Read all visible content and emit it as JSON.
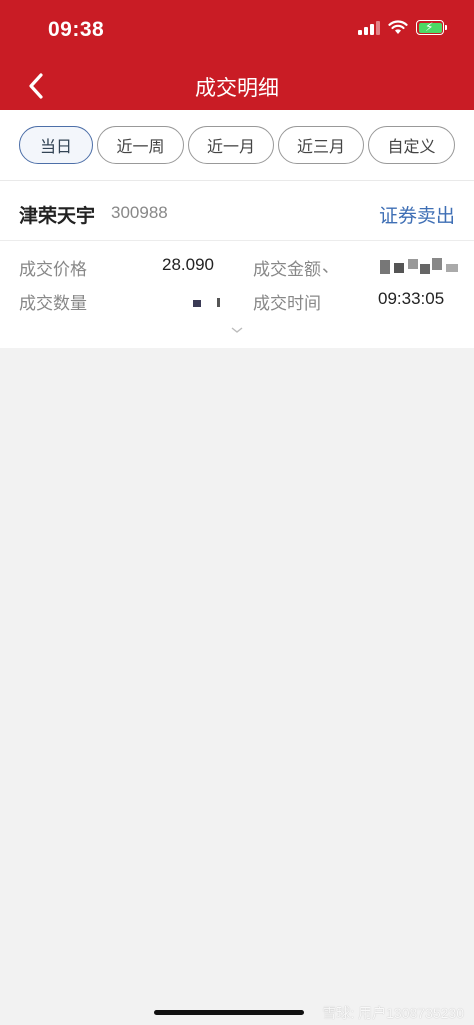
{
  "status_bar": {
    "time": "09:38"
  },
  "nav": {
    "title": "成交明细"
  },
  "filters": [
    {
      "label": "当日",
      "active": true
    },
    {
      "label": "近一周",
      "active": false
    },
    {
      "label": "近一月",
      "active": false
    },
    {
      "label": "近三月",
      "active": false
    },
    {
      "label": "自定义",
      "active": false
    }
  ],
  "trade": {
    "stock_name": "津荣天宇",
    "stock_code": "300988",
    "trade_type": "证券卖出",
    "price_label": "成交价格",
    "price_value": "28.090",
    "amount_label": "成交金额",
    "quantity_label": "成交数量",
    "time_label": "成交时间",
    "time_value": "09:33:05"
  },
  "watermark": "雪球: 用户1308735230",
  "colors": {
    "header": "#c91c25",
    "accent_blue": "#3f6fb5",
    "background": "#f2f2f2"
  }
}
